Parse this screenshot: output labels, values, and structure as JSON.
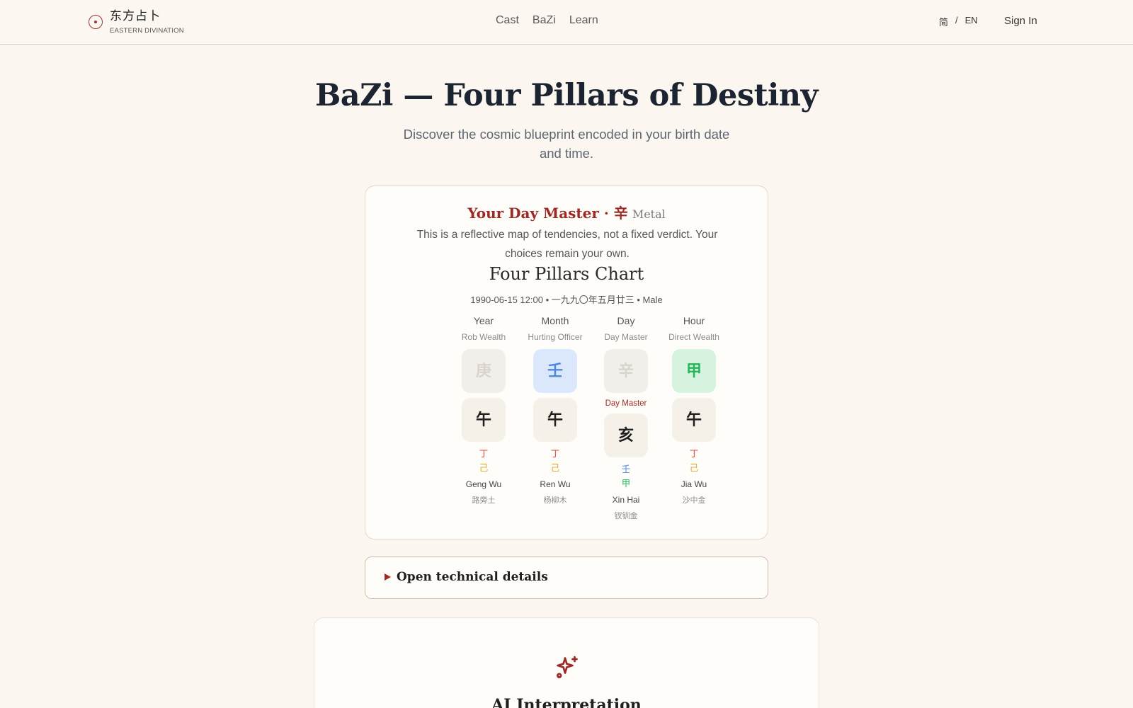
{
  "header": {
    "logo_cn": "东方占卜",
    "logo_en": "EASTERN DIVINATION",
    "nav": [
      "Cast",
      "BaZi",
      "Learn"
    ],
    "lang_cn": "简",
    "lang_sep": "/",
    "lang_en": "EN",
    "signin": "Sign In"
  },
  "hero": {
    "title": "BaZi — Four Pillars of Destiny",
    "subtitle": "Discover the cosmic blueprint encoded in your birth date and time."
  },
  "card": {
    "day_master_label": "Your Day Master · 辛",
    "day_master_element": "Metal",
    "note": "This is a reflective map of tendencies, not a fixed verdict. Your choices remain your own.",
    "chart_title": "Four Pillars Chart",
    "meta": "1990-06-15 12:00  •  一九九〇年五月廿三  •  Male",
    "day_master_tag": "Day Master",
    "pillars": [
      {
        "name": "Year",
        "god": "Rob Wealth",
        "stem": "庚",
        "branch": "午",
        "hidden": [
          "丁",
          "己"
        ],
        "pinyin": "Geng Wu",
        "nayin": "路旁土",
        "stem_bg": "#f1efea",
        "stem_color": "#d8d4cc"
      },
      {
        "name": "Month",
        "god": "Hurting Officer",
        "stem": "壬",
        "branch": "午",
        "hidden": [
          "丁",
          "己"
        ],
        "pinyin": "Ren Wu",
        "nayin": "杨柳木",
        "stem_bg": "#dbe8fc",
        "stem_color": "#4e86e0"
      },
      {
        "name": "Day",
        "god": "Day Master",
        "stem": "辛",
        "branch": "亥",
        "hidden": [
          "壬",
          "甲"
        ],
        "pinyin": "Xin Hai",
        "nayin": "钗钏金",
        "stem_bg": "#f1efea",
        "stem_color": "#d8d4cc"
      },
      {
        "name": "Hour",
        "god": "Direct Wealth",
        "stem": "甲",
        "branch": "午",
        "hidden": [
          "丁",
          "己"
        ],
        "pinyin": "Jia Wu",
        "nayin": "沙中金",
        "stem_bg": "#d5f3de",
        "stem_color": "#22b85a"
      }
    ],
    "hidden_colors": {
      "丁": "#e0463a",
      "己": "#e0a526",
      "壬": "#4e86e0",
      "甲": "#22b85a"
    }
  },
  "details": {
    "label": "Open technical details"
  },
  "ai": {
    "title": "AI Interpretation"
  },
  "colors": {
    "accent": "#9c2a24",
    "background": "#fcf6f0"
  }
}
